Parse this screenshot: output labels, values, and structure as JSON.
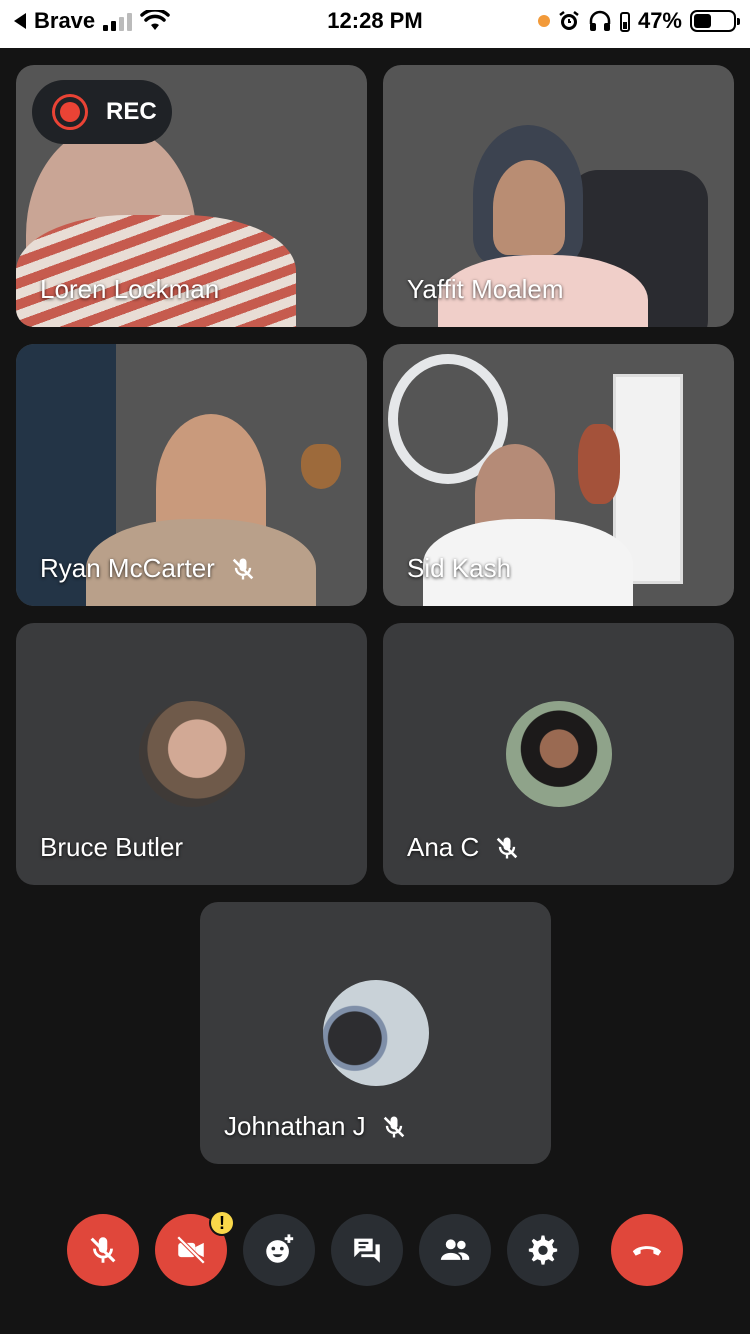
{
  "status_bar": {
    "back_app": "Brave",
    "time": "12:28 PM",
    "battery": "47%",
    "battery_level": 0.47
  },
  "recording": {
    "label": "REC"
  },
  "participants": [
    {
      "name": "Loren Lockman",
      "muted": false,
      "video": true
    },
    {
      "name": "Yaffit Moalem",
      "muted": false,
      "video": true
    },
    {
      "name": "Ryan McCarter",
      "muted": true,
      "video": true
    },
    {
      "name": "Sid Kash",
      "muted": false,
      "video": true
    },
    {
      "name": "Bruce Butler",
      "muted": false,
      "video": false
    },
    {
      "name": "Ana C",
      "muted": true,
      "video": false
    },
    {
      "name": "Johnathan J",
      "muted": true,
      "video": false
    }
  ],
  "toolbar": {
    "buttons": [
      {
        "icon": "mic-off-icon",
        "state": "off"
      },
      {
        "icon": "camera-off-icon",
        "state": "off",
        "warning": "!"
      },
      {
        "icon": "add-reaction-icon"
      },
      {
        "icon": "chat-icon"
      },
      {
        "icon": "people-icon"
      },
      {
        "icon": "settings-icon"
      },
      {
        "icon": "end-call-icon"
      }
    ]
  },
  "colors": {
    "background": "#141414",
    "tile": "#3a3b3d",
    "button": "#2a2e33",
    "danger": "#e0473b",
    "rec": "#ea4335",
    "warning": "#f9d84a"
  }
}
